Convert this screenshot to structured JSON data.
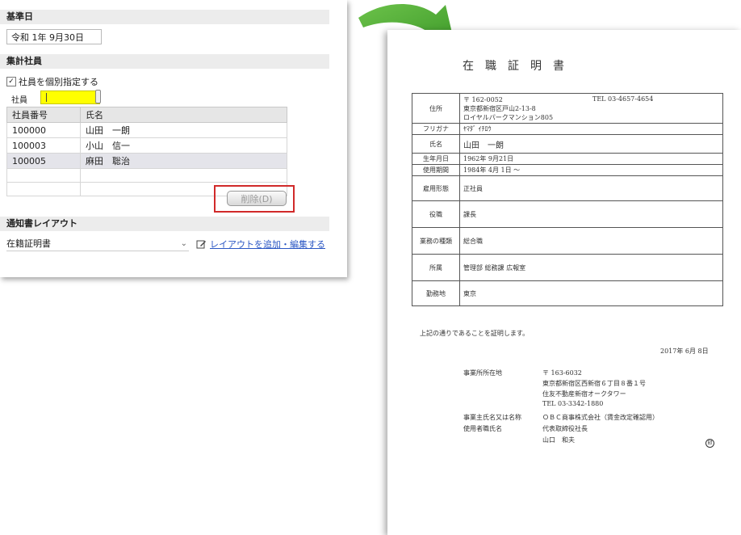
{
  "settings": {
    "base_date_section": "基準日",
    "base_date_value": "令和 1年 9月30日",
    "employees_section": "集計社員",
    "individual_checkbox": "社員を個別指定する",
    "employee_label": "社員",
    "table_headers": [
      "社員番号",
      "氏名"
    ],
    "table_rows": [
      [
        "100000",
        "山田　一朗"
      ],
      [
        "100003",
        "小山　信一"
      ],
      [
        "100005",
        "麻田　聡治"
      ],
      [
        "",
        ""
      ],
      [
        "",
        ""
      ]
    ],
    "delete_button": "削除(D)",
    "layout_section": "通知書レイアウト",
    "layout_selected": "在籍証明書",
    "edit_layout_link": "レイアウトを追加・編集する",
    "highlight_color": "#d12a2a",
    "input_highlight": "#ffff00"
  },
  "certificate": {
    "title": "在職証明書",
    "postal": "〒 162-0052",
    "tel": "TEL 03-4657-4654",
    "address_line1": "東京都新宿区戸山2-13-8",
    "address_line2": "ロイヤルパークマンション805",
    "rows": [
      {
        "label": "住所",
        "value": ""
      },
      {
        "label": "フリガナ",
        "value": "ﾔﾏﾀﾞ ｲﾁﾛｳ"
      },
      {
        "label": "氏名",
        "value": "山田　一朗"
      },
      {
        "label": "生年月日",
        "value": "1962年 9月21日"
      },
      {
        "label": "使用期間",
        "value": "1984年 4月 1日 〜"
      },
      {
        "label": "雇用形態",
        "value": "正社員"
      },
      {
        "label": "役職",
        "value": "課長"
      },
      {
        "label": "業務の種類",
        "value": "総合職"
      },
      {
        "label": "所属",
        "value": "管理部 総務課 広報室"
      },
      {
        "label": "勤務地",
        "value": "東京"
      }
    ],
    "statement": "上記の通りであることを証明します。",
    "issue_date": "2017年 6月 8日",
    "office_label": "事業所所在地",
    "office_postal": "〒 163-6032",
    "office_addr1": "東京都新宿区西新宿６丁目８番１号",
    "office_addr2": "住友不動産新宿オークタワー",
    "office_tel": "TEL 03-3342-1880",
    "employer_label": "事業主氏名又は名称",
    "employer_name": "ＯＢＣ商事株式会社（賃金改定確認用）",
    "rep_label": "使用者職氏名",
    "rep_title": "代表取締役社長",
    "rep_name": "山口　和夫",
    "seal": "印"
  }
}
